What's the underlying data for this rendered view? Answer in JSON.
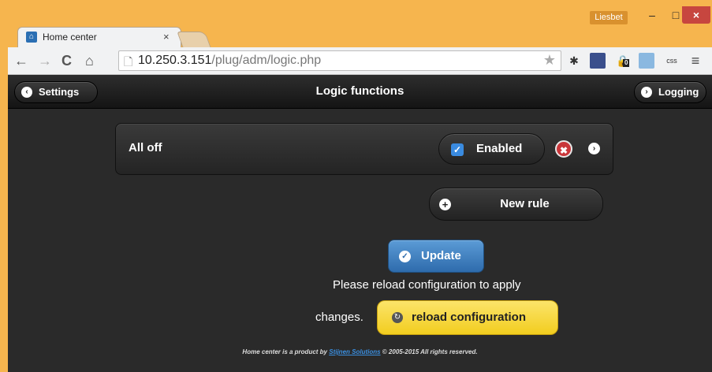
{
  "window": {
    "user_label": "Liesbet",
    "minimize_glyph": "–",
    "maximize_glyph": "□",
    "close_glyph": "×"
  },
  "tab": {
    "title": "Home center",
    "close_glyph": "×"
  },
  "browser": {
    "url_host": "10.250.3.151",
    "url_path": "/plug/adm/logic.php",
    "back_glyph": "←",
    "forward_glyph": "→",
    "reload_glyph": "C",
    "home_glyph": "⌂",
    "star_glyph": "★",
    "menu_glyph": "≡",
    "ext_badge": "0",
    "ext_css_label": "css"
  },
  "header": {
    "title": "Logic functions",
    "back_button": "Settings",
    "forward_button": "Logging"
  },
  "rules": [
    {
      "name": "All off",
      "enabled_label": "Enabled",
      "enabled": true
    }
  ],
  "actions": {
    "new_rule": "New rule",
    "update": "Update",
    "reload_message_line1": "Please reload configuration to apply",
    "reload_message_line2": "changes.",
    "reload": "reload configuration"
  },
  "footer": {
    "prefix": "Home center is a product by ",
    "link": "Stijnen Solutions",
    "suffix": " © 2005-2015 All rights reserved."
  },
  "colors": {
    "frame": "#f6b54e",
    "app_bg": "#2a2a2a",
    "update_blue": "#2e6bac",
    "reload_yellow": "#f2cd1f",
    "delete_red": "#c9363a"
  }
}
